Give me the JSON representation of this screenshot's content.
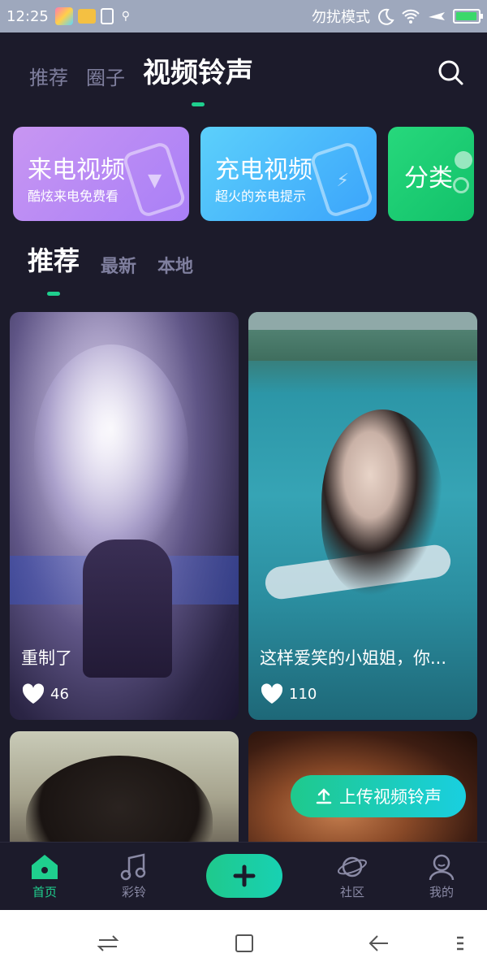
{
  "status_bar": {
    "time": "12:25",
    "dnd_label": "勿扰模式",
    "battery_level": 0.95
  },
  "top_tabs": [
    {
      "label": "推荐",
      "active": false
    },
    {
      "label": "圈子",
      "active": false
    },
    {
      "label": "视频铃声",
      "active": true
    }
  ],
  "cards": [
    {
      "title": "来电视频",
      "subtitle": "酷炫来电免费看",
      "icon": "phone-video-icon"
    },
    {
      "title": "充电视频",
      "subtitle": "超火的充电提示",
      "icon": "battery-charge-icon"
    },
    {
      "title": "分类",
      "icon": "category-icon"
    }
  ],
  "sub_tabs": [
    {
      "label": "推荐",
      "active": true
    },
    {
      "label": "最新",
      "active": false
    },
    {
      "label": "本地",
      "active": false
    }
  ],
  "videos": [
    {
      "caption": "重制了",
      "likes": "46"
    },
    {
      "caption": "这样爱笑的小姐姐，你...",
      "likes": "110"
    },
    {
      "caption": "",
      "likes": ""
    },
    {
      "caption": "",
      "likes": ""
    }
  ],
  "upload_button": {
    "label": "上传视频铃声"
  },
  "bottom_nav": [
    {
      "label": "首页",
      "icon": "home-icon",
      "active": true
    },
    {
      "label": "彩铃",
      "icon": "music-note-icon",
      "active": false
    },
    {
      "label": "",
      "icon": "plus-icon",
      "active": false
    },
    {
      "label": "社区",
      "icon": "planet-icon",
      "active": false
    },
    {
      "label": "我的",
      "icon": "user-icon",
      "active": false
    }
  ],
  "colors": {
    "accent": "#1fcf8e",
    "background": "#1c1b2b",
    "inactive": "#7f7f9e"
  }
}
